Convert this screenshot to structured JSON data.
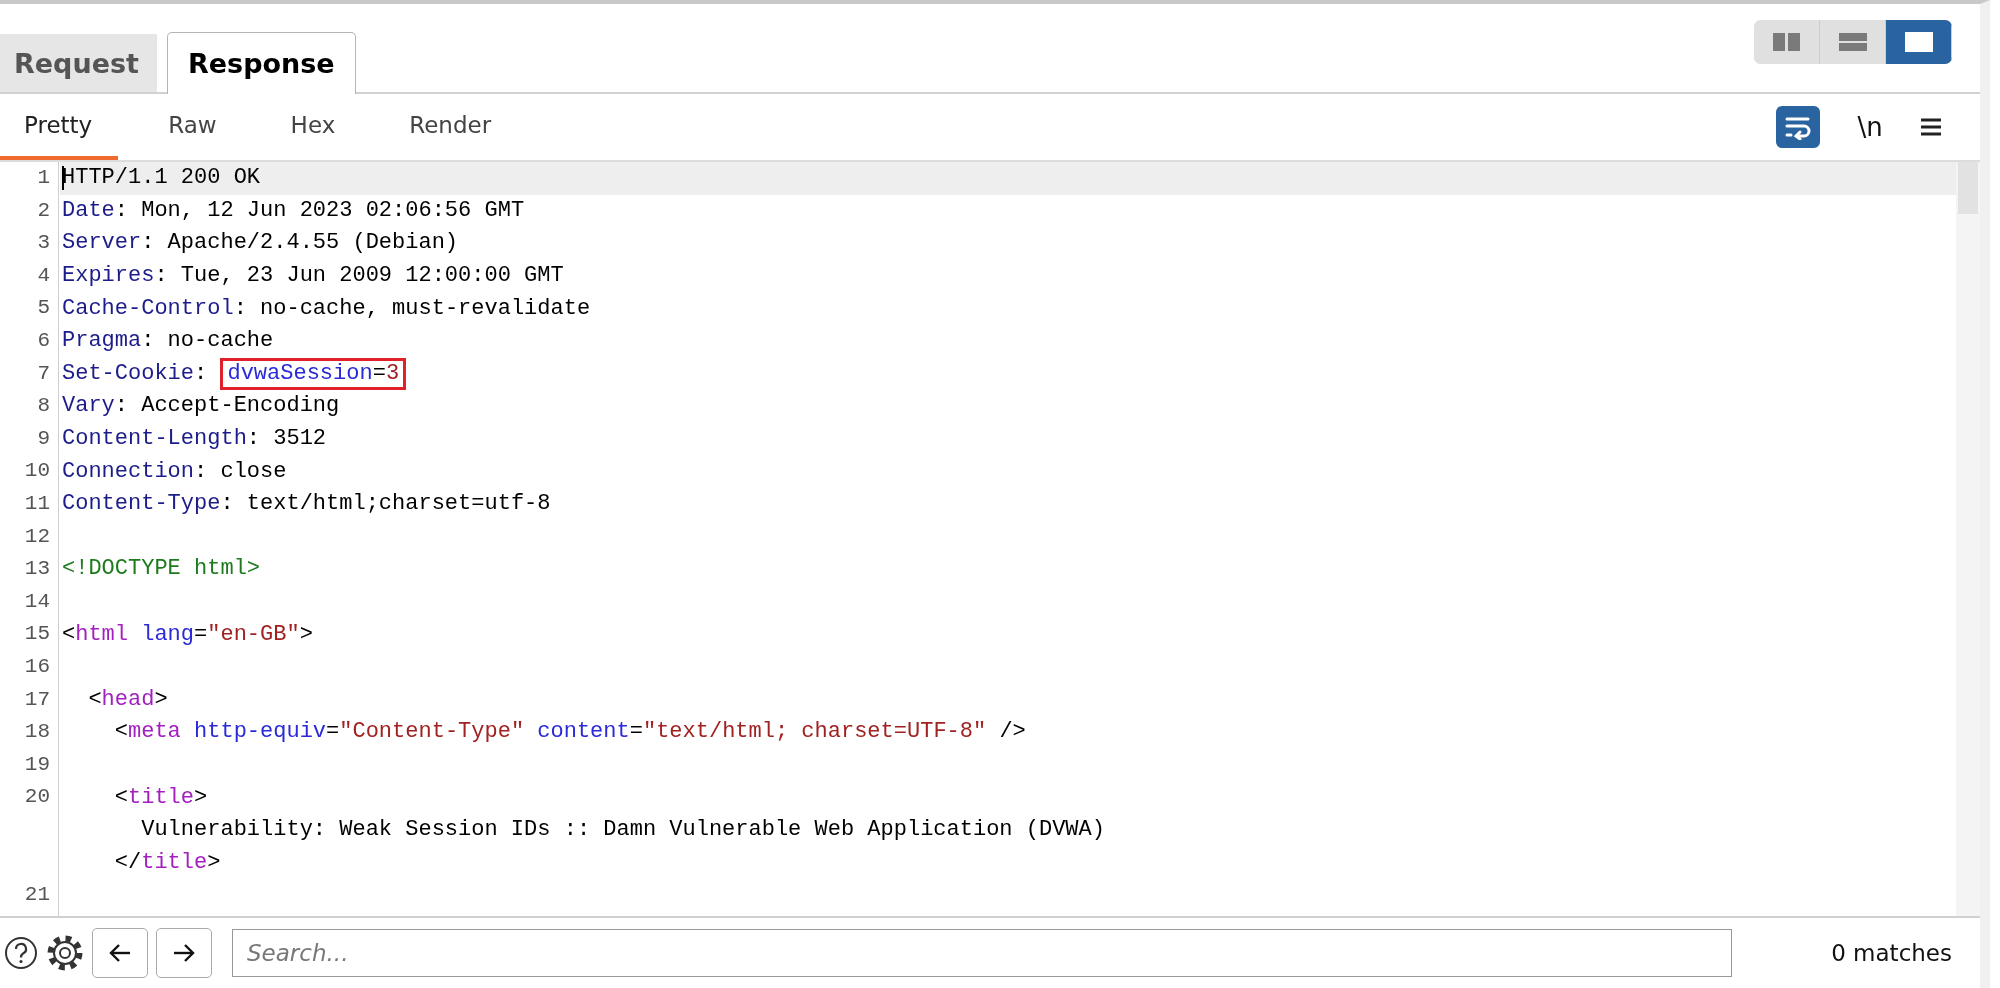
{
  "message_tabs": [
    {
      "label": "Request",
      "selected": false
    },
    {
      "label": "Response",
      "selected": true
    }
  ],
  "layout_buttons": [
    {
      "kind": "columns",
      "selected": false
    },
    {
      "kind": "rows",
      "selected": false
    },
    {
      "kind": "single",
      "selected": true
    }
  ],
  "view_tabs": [
    {
      "label": "Pretty",
      "selected": true
    },
    {
      "label": "Raw",
      "selected": false
    },
    {
      "label": "Hex",
      "selected": false
    },
    {
      "label": "Render",
      "selected": false
    }
  ],
  "editor_tools": {
    "wrap": {
      "on": true
    },
    "newline": {
      "label": "\\n",
      "on": false
    }
  },
  "lines": [
    {
      "number": "1",
      "current": true,
      "rows": [
        [
          {
            "tokens": [
              {
                "text": "HTTP/1.1 200 OK",
                "kind": "plain"
              }
            ]
          }
        ]
      ]
    },
    {
      "number": "2",
      "current": false,
      "rows": [
        [
          {
            "tokens": [
              {
                "text": "Date",
                "kind": "header"
              },
              {
                "text": ": Mon, 12 Jun 2023 02:06:56 GMT",
                "kind": "plain"
              }
            ]
          }
        ]
      ]
    },
    {
      "number": "3",
      "current": false,
      "rows": [
        [
          {
            "tokens": [
              {
                "text": "Server",
                "kind": "header"
              },
              {
                "text": ": Apache/2.4.55 (Debian)",
                "kind": "plain"
              }
            ]
          }
        ]
      ]
    },
    {
      "number": "4",
      "current": false,
      "rows": [
        [
          {
            "tokens": [
              {
                "text": "Expires",
                "kind": "header"
              },
              {
                "text": ": Tue, 23 Jun 2009 12:00:00 GMT",
                "kind": "plain"
              }
            ]
          }
        ]
      ]
    },
    {
      "number": "5",
      "current": false,
      "rows": [
        [
          {
            "tokens": [
              {
                "text": "Cache-Control",
                "kind": "header"
              },
              {
                "text": ": no-cache, must-revalidate",
                "kind": "plain"
              }
            ]
          }
        ]
      ]
    },
    {
      "number": "6",
      "current": false,
      "rows": [
        [
          {
            "tokens": [
              {
                "text": "Pragma",
                "kind": "header"
              },
              {
                "text": ": no-cache",
                "kind": "plain"
              }
            ]
          }
        ]
      ]
    },
    {
      "number": "7",
      "current": false,
      "rows": [
        [
          {
            "tokens": [
              {
                "text": "Set-Cookie",
                "kind": "header"
              },
              {
                "text": ": ",
                "kind": "plain"
              }
            ]
          },
          {
            "boxed": true,
            "tokens": [
              {
                "text": "dvwaSession",
                "kind": "attr"
              },
              {
                "text": "=",
                "kind": "plain"
              },
              {
                "text": "3",
                "kind": "string"
              }
            ]
          }
        ]
      ]
    },
    {
      "number": "8",
      "current": false,
      "rows": [
        [
          {
            "tokens": [
              {
                "text": "Vary",
                "kind": "header"
              },
              {
                "text": ": Accept-Encoding",
                "kind": "plain"
              }
            ]
          }
        ]
      ]
    },
    {
      "number": "9",
      "current": false,
      "rows": [
        [
          {
            "tokens": [
              {
                "text": "Content-Length",
                "kind": "header"
              },
              {
                "text": ": 3512",
                "kind": "plain"
              }
            ]
          }
        ]
      ]
    },
    {
      "number": "10",
      "current": false,
      "rows": [
        [
          {
            "tokens": [
              {
                "text": "Connection",
                "kind": "header"
              },
              {
                "text": ": close",
                "kind": "plain"
              }
            ]
          }
        ]
      ]
    },
    {
      "number": "11",
      "current": false,
      "rows": [
        [
          {
            "tokens": [
              {
                "text": "Content-Type",
                "kind": "header"
              },
              {
                "text": ": text/html;charset=utf-8",
                "kind": "plain"
              }
            ]
          }
        ]
      ]
    },
    {
      "number": "12",
      "current": false
    },
    {
      "number": "13",
      "current": false,
      "rows": [
        [
          {
            "tokens": [
              {
                "text": "<!DOCTYPE html>",
                "kind": "doctype"
              }
            ]
          }
        ]
      ]
    },
    {
      "number": "14",
      "current": false
    },
    {
      "number": "15",
      "current": false,
      "rows": [
        [
          {
            "tokens": [
              {
                "text": "<",
                "kind": "plain"
              },
              {
                "text": "html",
                "kind": "tag"
              },
              {
                "text": " lang",
                "kind": "attr"
              },
              {
                "text": "=",
                "kind": "plain"
              },
              {
                "text": "\"en-GB\"",
                "kind": "string"
              },
              {
                "text": ">",
                "kind": "plain"
              }
            ]
          }
        ]
      ]
    },
    {
      "number": "16",
      "current": false
    },
    {
      "number": "17",
      "current": false,
      "rows": [
        [
          {
            "tokens": [
              {
                "text": "  <",
                "kind": "plain"
              },
              {
                "text": "head",
                "kind": "tag"
              },
              {
                "text": ">",
                "kind": "plain"
              }
            ]
          }
        ]
      ]
    },
    {
      "number": "18",
      "current": false,
      "rows": [
        [
          {
            "tokens": [
              {
                "text": "    <",
                "kind": "plain"
              },
              {
                "text": "meta",
                "kind": "tag"
              },
              {
                "text": " http-equiv",
                "kind": "attr"
              },
              {
                "text": "=",
                "kind": "plain"
              },
              {
                "text": "\"Content-Type\"",
                "kind": "string"
              },
              {
                "text": " content",
                "kind": "attr"
              },
              {
                "text": "=",
                "kind": "plain"
              },
              {
                "text": "\"text/html; charset=UTF-8\"",
                "kind": "string"
              },
              {
                "text": " />",
                "kind": "plain"
              }
            ]
          }
        ]
      ]
    },
    {
      "number": "19",
      "current": false
    },
    {
      "number": "20",
      "current": false,
      "rows": [
        [
          {
            "tokens": [
              {
                "text": "    <",
                "kind": "plain"
              },
              {
                "text": "title",
                "kind": "tag"
              },
              {
                "text": ">",
                "kind": "plain"
              }
            ]
          }
        ],
        [
          {
            "tokens": [
              {
                "text": "      Vulnerability: Weak Session IDs :: Damn Vulnerable Web Application (DVWA)",
                "kind": "plain"
              }
            ]
          }
        ],
        [
          {
            "tokens": [
              {
                "text": "    </",
                "kind": "plain"
              },
              {
                "text": "title",
                "kind": "tag"
              },
              {
                "text": ">",
                "kind": "plain"
              }
            ]
          }
        ]
      ]
    },
    {
      "number": "21",
      "current": false
    }
  ],
  "search": {
    "placeholder": "Search...",
    "matches": "0 matches"
  }
}
